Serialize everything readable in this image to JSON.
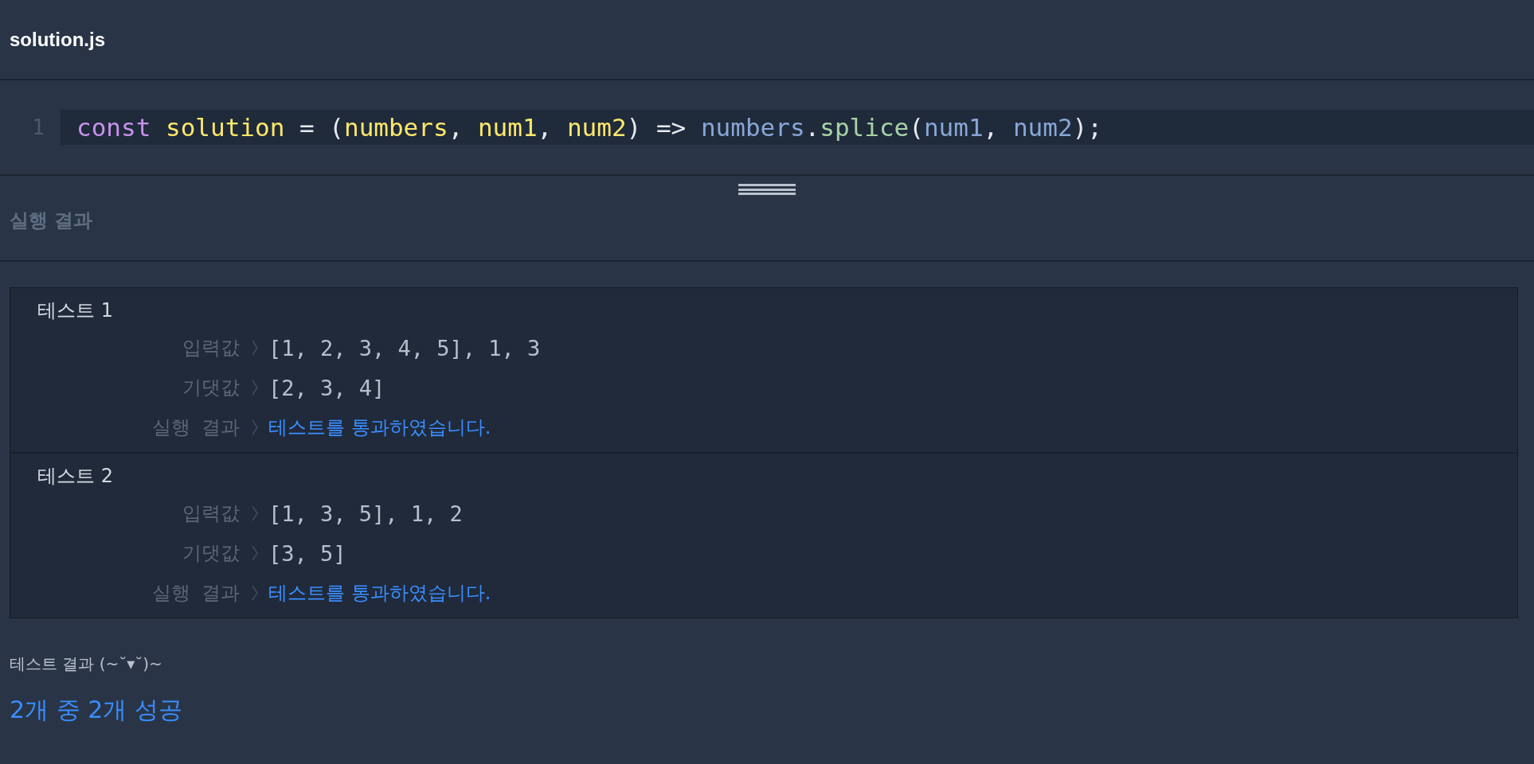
{
  "file_title": "solution.js",
  "code": {
    "lines": [
      {
        "number": "1",
        "active": true,
        "tokens": [
          {
            "text": "const",
            "kind": "keyword"
          },
          {
            "text": " solution",
            "kind": "ident"
          },
          {
            "text": " = (",
            "kind": "plain"
          },
          {
            "text": "numbers",
            "kind": "ident"
          },
          {
            "text": ", ",
            "kind": "plain"
          },
          {
            "text": "num1",
            "kind": "ident"
          },
          {
            "text": ", ",
            "kind": "plain"
          },
          {
            "text": "num2",
            "kind": "ident"
          },
          {
            "text": ") => ",
            "kind": "plain"
          },
          {
            "text": "numbers",
            "kind": "ref"
          },
          {
            "text": ".",
            "kind": "plain"
          },
          {
            "text": "splice",
            "kind": "method"
          },
          {
            "text": "(",
            "kind": "plain"
          },
          {
            "text": "num1",
            "kind": "ref"
          },
          {
            "text": ", ",
            "kind": "plain"
          },
          {
            "text": "num2",
            "kind": "ref"
          },
          {
            "text": ");",
            "kind": "plain"
          }
        ]
      }
    ]
  },
  "results_title": "실행 결과",
  "tests": [
    {
      "title": "테스트 1",
      "rows": [
        {
          "label": "입력값",
          "value": "[1, 2, 3, 4, 5], 1, 3",
          "kind": "value"
        },
        {
          "label": "기댓값",
          "value": "[2, 3, 4]",
          "kind": "value"
        },
        {
          "label": "실행 결과",
          "value": "테스트를 통과하였습니다.",
          "kind": "result"
        }
      ]
    },
    {
      "title": "테스트 2",
      "rows": [
        {
          "label": "입력값",
          "value": "[1, 3, 5], 1, 2",
          "kind": "value"
        },
        {
          "label": "기댓값",
          "value": "[3, 5]",
          "kind": "value"
        },
        {
          "label": "실행 결과",
          "value": "테스트를 통과하였습니다.",
          "kind": "result"
        }
      ]
    }
  ],
  "summary": {
    "heading": "테스트 결과 (~˘▾˘)~",
    "result": "2개 중 2개 성공"
  }
}
